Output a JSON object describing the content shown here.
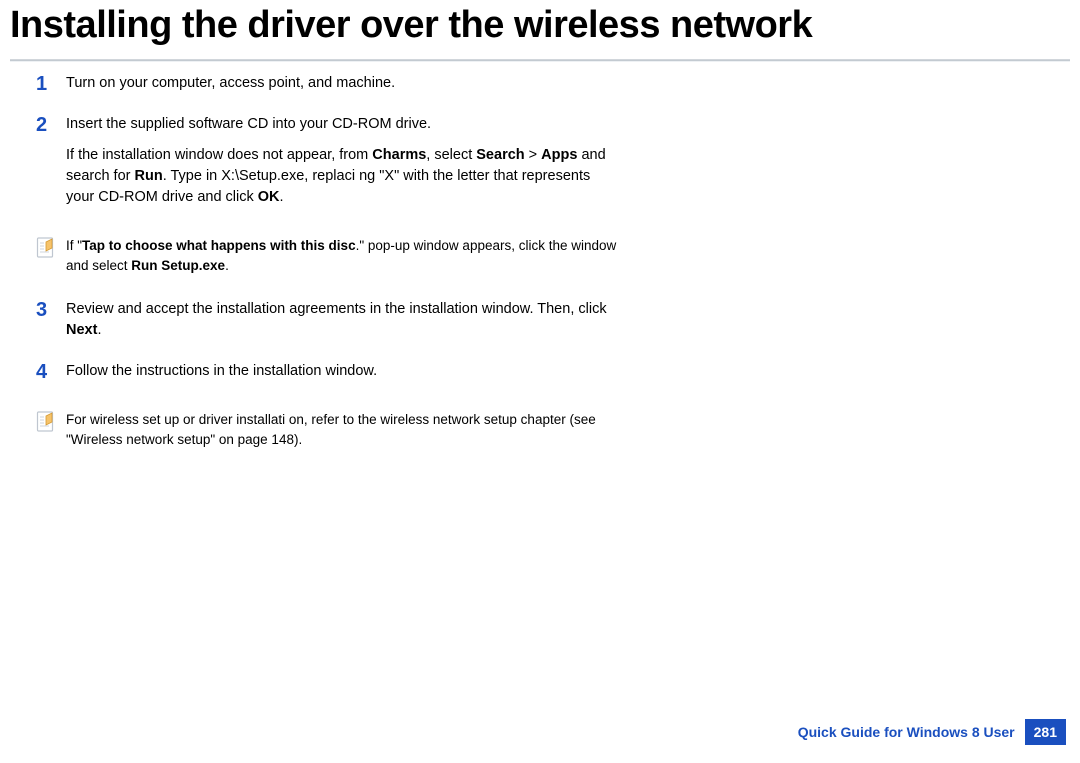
{
  "title": "Installing the driver over the wireless network",
  "steps": {
    "s1": {
      "num": "1",
      "text": "Turn on your computer, access point, and machine."
    },
    "s2": {
      "num": "2",
      "p1": "Insert the supplied software CD into your CD-ROM drive.",
      "p2a": "If the installation window does not appear, from ",
      "p2b": "Charms",
      "p2c": ", select ",
      "p2d": "Search",
      "p2e": " > ",
      "p2f": "Apps",
      "p2g": " and search for ",
      "p2h": "Run",
      "p2i": ". Type in X:\\Setup.exe, replaci ng \"X\" with the letter that represents your CD-ROM drive and click ",
      "p2j": "OK",
      "p2k": "."
    },
    "s3": {
      "num": "3",
      "a": "Review and accept the installation agreements in the installation window. Then, click ",
      "b": "Next",
      "c": "."
    },
    "s4": {
      "num": "4",
      "text": "Follow the instructions in the installation window."
    }
  },
  "note1": {
    "a": "If \"",
    "b": "Tap to choose what happens with this disc",
    "c": ".\" pop-up window appears, click the window and select ",
    "d": "Run Setup.exe",
    "e": "."
  },
  "note2": {
    "text": "For wireless set up or driver installati on, refer to the wireless network setup chapter (see \"Wireless network setup\" on page 148)."
  },
  "footer": {
    "text": "Quick Guide for Windows 8 User",
    "page": "281"
  }
}
